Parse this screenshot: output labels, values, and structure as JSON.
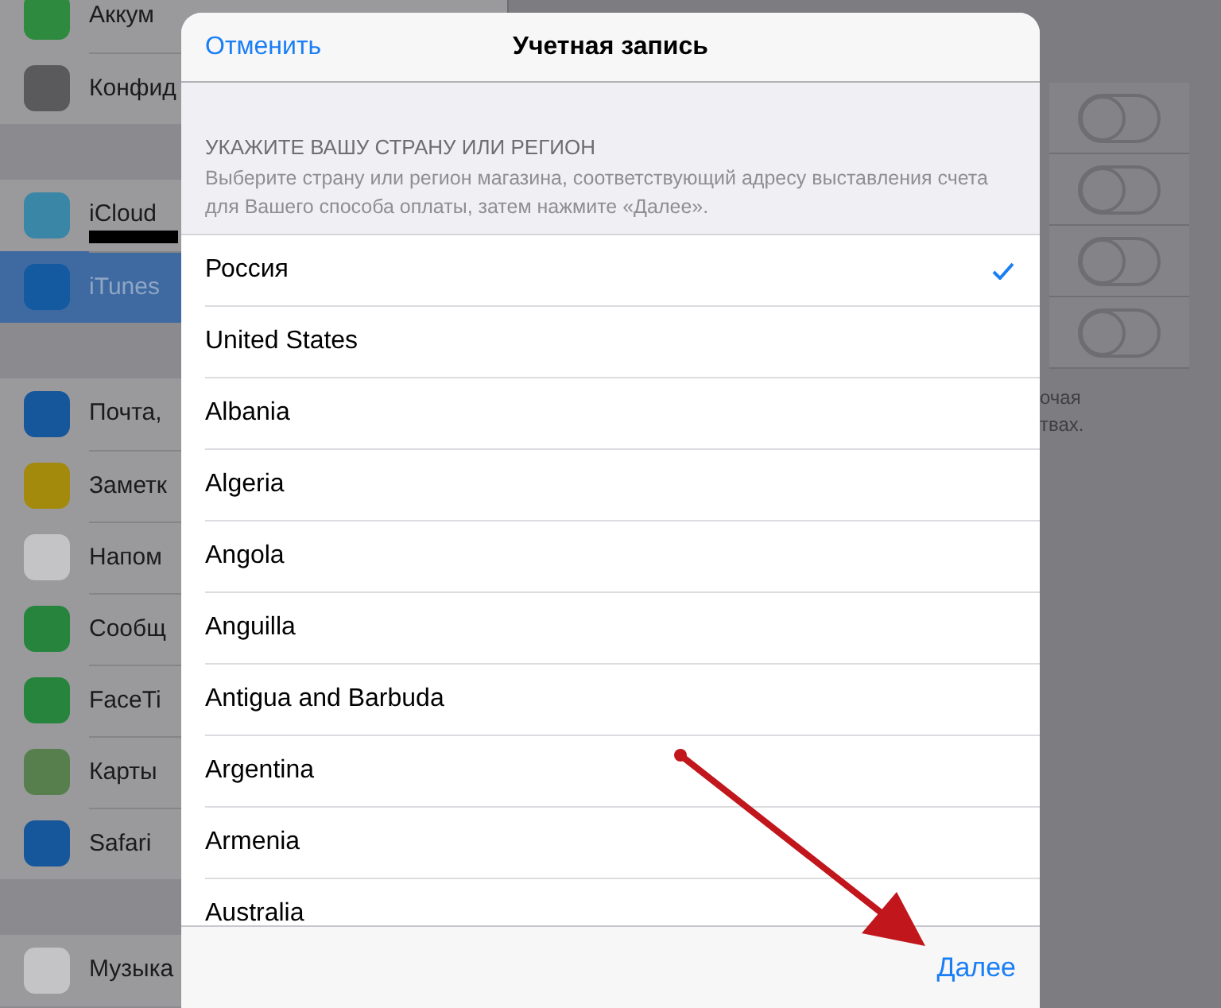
{
  "sidebar": {
    "groups": [
      {
        "items": [
          {
            "label": "Аккум",
            "color": "#2e8a3e",
            "selected": false,
            "redacted": false
          },
          {
            "label": "Конфид",
            "color": "#5a5a5d",
            "selected": false,
            "redacted": false
          }
        ]
      },
      {
        "items": [
          {
            "label": "iCloud",
            "color": "#3a86a6",
            "selected": false,
            "redacted": true
          },
          {
            "label": "iTunes",
            "color": "#145aa0",
            "selected": true,
            "redacted": false
          }
        ]
      },
      {
        "items": [
          {
            "label": "Почта,",
            "color": "#15579a",
            "selected": false,
            "redacted": false
          },
          {
            "label": "Заметк",
            "color": "#a48a0c",
            "selected": false,
            "redacted": false
          },
          {
            "label": "Напом",
            "color": "#c4c4c7",
            "selected": false,
            "redacted": false
          },
          {
            "label": "Сообщ",
            "color": "#27843d",
            "selected": false,
            "redacted": false
          },
          {
            "label": "FaceTi",
            "color": "#27843d",
            "selected": false,
            "redacted": false
          },
          {
            "label": "Карты",
            "color": "#577f4d",
            "selected": false,
            "redacted": false
          },
          {
            "label": "Safari",
            "color": "#15579a",
            "selected": false,
            "redacted": false
          }
        ]
      },
      {
        "items": [
          {
            "label": "Музыка",
            "color": "#c4c4c7",
            "selected": false,
            "redacted": false
          }
        ]
      }
    ]
  },
  "detail": {
    "toggles": [
      {
        "on": false
      },
      {
        "on": false
      },
      {
        "on": false
      },
      {
        "on": false
      }
    ],
    "footnote": [
      "очая",
      "твах."
    ]
  },
  "dialog": {
    "cancel": "Отменить",
    "title": "Учетная запись",
    "section_title": "УКАЖИТЕ ВАШУ СТРАНУ ИЛИ РЕГИОН",
    "section_text": "Выберите страну или регион магазина, соответствующий адресу выставления счета для Вашего способа оплаты, затем нажмите «Далее».",
    "countries": [
      {
        "label": "Россия",
        "selected": true
      },
      {
        "label": "United States",
        "selected": false
      },
      {
        "label": "Albania",
        "selected": false
      },
      {
        "label": "Algeria",
        "selected": false
      },
      {
        "label": "Angola",
        "selected": false
      },
      {
        "label": "Anguilla",
        "selected": false
      },
      {
        "label": "Antigua and Barbuda",
        "selected": false
      },
      {
        "label": "Argentina",
        "selected": false
      },
      {
        "label": "Armenia",
        "selected": false
      },
      {
        "label": "Australia",
        "selected": false
      }
    ],
    "next": "Далее"
  }
}
